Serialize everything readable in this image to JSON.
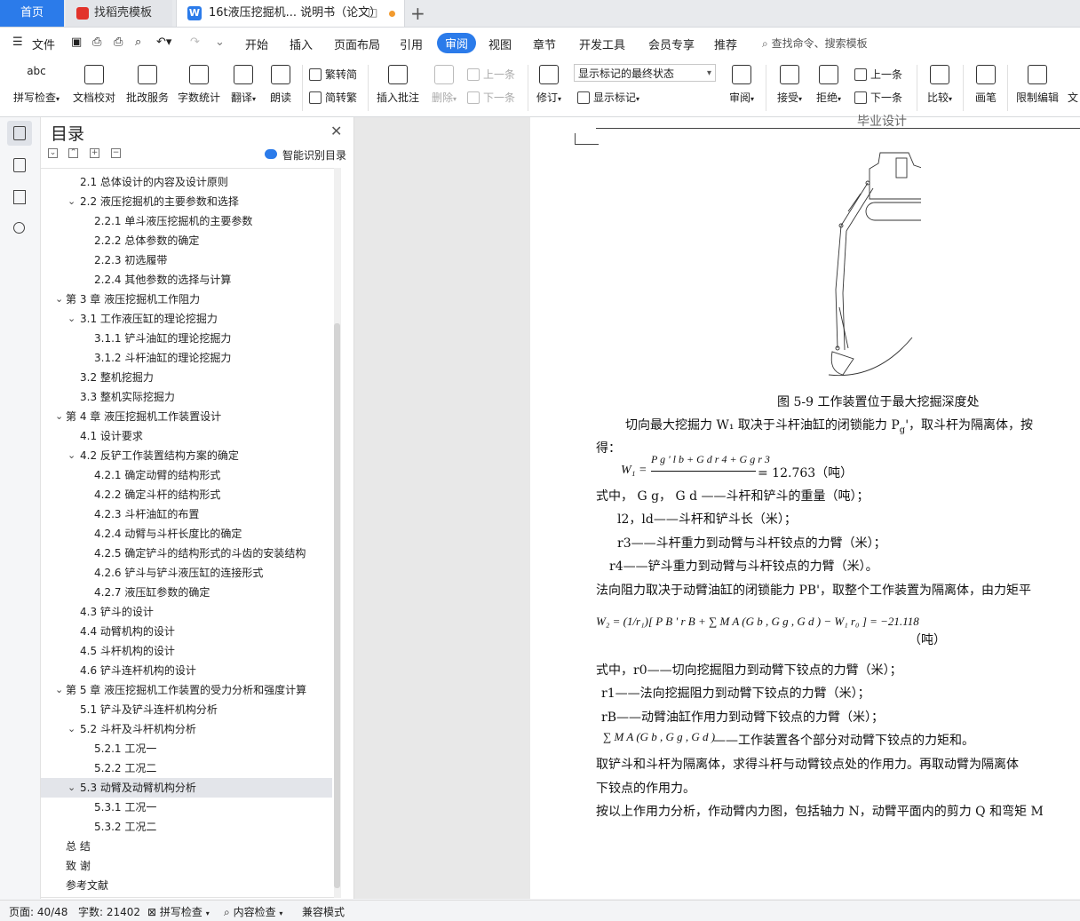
{
  "tabs": {
    "home": "首页",
    "template": "找稻壳模板",
    "doc": "16t液压挖掘机... 说明书（论文）"
  },
  "menu": {
    "file": "文件",
    "items": [
      "开始",
      "插入",
      "页面布局",
      "引用",
      "审阅",
      "视图",
      "章节",
      "开发工具",
      "会员专享",
      "推荐"
    ],
    "active": "审阅",
    "search": "查找命令、搜索模板"
  },
  "ribbon": {
    "spell": "拼写检查",
    "proofread": "文档校对",
    "batch": "批改服务",
    "wordcount": "字数统计",
    "translate": "翻译",
    "read": "朗读",
    "trad": "繁转简",
    "simp": "简转繁",
    "comment": "插入批注",
    "delete": "删除",
    "prev_comment": "上一条",
    "next_comment": "下一条",
    "revise": "修订",
    "markup_state": "显示标记的最终状态",
    "show_markup": "显示标记",
    "review": "审阅",
    "accept": "接受",
    "reject": "拒绝",
    "prev_change": "上一条",
    "next_change": "下一条",
    "compare": "比较",
    "pen": "画笔",
    "restrict": "限制编辑",
    "doc_more": "文"
  },
  "toc": {
    "title": "目录",
    "smart": "智能识别目录",
    "items": [
      {
        "label": "2.1  总体设计的内容及设计原则",
        "level": 2,
        "caret": ""
      },
      {
        "label": "2.2  液压挖掘机的主要参数和选择",
        "level": 2,
        "caret": "v"
      },
      {
        "label": "2.2.1  单斗液压挖掘机的主要参数",
        "level": 3,
        "caret": ""
      },
      {
        "label": "2.2.2  总体参数的确定",
        "level": 3,
        "caret": ""
      },
      {
        "label": "2.2.3 初选履带",
        "level": 3,
        "caret": ""
      },
      {
        "label": "2.2.4 其他参数的选择与计算",
        "level": 3,
        "caret": ""
      },
      {
        "label": "第 3 章  液压挖掘机工作阻力",
        "level": 1,
        "caret": "v"
      },
      {
        "label": "3.1  工作液压缸的理论挖掘力",
        "level": 2,
        "caret": "v"
      },
      {
        "label": "3.1.1 铲斗油缸的理论挖掘力",
        "level": 3,
        "caret": ""
      },
      {
        "label": "3.1.2  斗杆油缸的理论挖掘力",
        "level": 3,
        "caret": ""
      },
      {
        "label": "3.2  整机挖掘力",
        "level": 2,
        "caret": ""
      },
      {
        "label": "3.3  整机实际挖掘力",
        "level": 2,
        "caret": ""
      },
      {
        "label": "第 4 章  液压挖掘机工作装置设计",
        "level": 1,
        "caret": "v"
      },
      {
        "label": "4.1 设计要求",
        "level": 2,
        "caret": ""
      },
      {
        "label": "4.2 反铲工作装置结构方案的确定",
        "level": 2,
        "caret": "v"
      },
      {
        "label": "4.2.1 确定动臂的结构形式",
        "level": 3,
        "caret": ""
      },
      {
        "label": "4.2.2 确定斗杆的结构形式",
        "level": 3,
        "caret": ""
      },
      {
        "label": "4.2.3 斗杆油缸的布置",
        "level": 3,
        "caret": ""
      },
      {
        "label": "4.2.4 动臂与斗杆长度比的确定",
        "level": 3,
        "caret": ""
      },
      {
        "label": "4.2.5 确定铲斗的结构形式的斗齿的安装结构",
        "level": 3,
        "caret": ""
      },
      {
        "label": "4.2.6 铲斗与铲斗液压缸的连接形式",
        "level": 3,
        "caret": ""
      },
      {
        "label": "4.2.7 液压缸参数的确定",
        "level": 3,
        "caret": ""
      },
      {
        "label": "4.3  铲斗的设计",
        "level": 2,
        "caret": ""
      },
      {
        "label": "4.4 动臂机构的设计",
        "level": 2,
        "caret": ""
      },
      {
        "label": "4.5 斗杆机构的设计",
        "level": 2,
        "caret": ""
      },
      {
        "label": "4.6  铲斗连杆机构的设计",
        "level": 2,
        "caret": ""
      },
      {
        "label": "第 5 章  液压挖掘机工作装置的受力分析和强度计算",
        "level": 1,
        "caret": "v"
      },
      {
        "label": "5.1 铲斗及铲斗连杆机构分析",
        "level": 2,
        "caret": ""
      },
      {
        "label": "5.2 斗杆及斗杆机构分析",
        "level": 2,
        "caret": "v"
      },
      {
        "label": "5.2.1 工况一",
        "level": 3,
        "caret": ""
      },
      {
        "label": "5.2.2 工况二",
        "level": 3,
        "caret": ""
      },
      {
        "label": "5.3 动臂及动臂机构分析",
        "level": 2,
        "caret": "v",
        "selected": true
      },
      {
        "label": "5.3.1 工况一",
        "level": 3,
        "caret": ""
      },
      {
        "label": "5.3.2 工况二",
        "level": 3,
        "caret": ""
      },
      {
        "label": "总    结",
        "level": 1,
        "caret": ""
      },
      {
        "label": "致    谢",
        "level": 1,
        "caret": ""
      },
      {
        "label": "参考文献",
        "level": 1,
        "caret": ""
      }
    ]
  },
  "document": {
    "header": "毕业设计",
    "figure_caption": "图 5-9 工作装置位于最大挖掘深度处",
    "p1": "切向最大挖掘力 W₁ 取决于斗杆油缸的闭锁能力 P",
    "p1b": "g",
    "p1c": "'，取斗杆为隔离体，按",
    "p1d": "得：",
    "eq1_lhs": "W₁ =",
    "eq1_num": "P g ' l b + G d r 4 + G g r 3",
    "eq1_val": "= 12.763（吨）",
    "w1": "式中， G g， G d ——斗杆和铲斗的重量（吨）；",
    "w2": "l2，ld——斗杆和铲斗长（米）；",
    "w3": "r3——斗杆重力到动臂与斗杆铰点的力臂（米）；",
    "w4": "r4——铲斗重力到动臂与斗杆铰点的力臂（米）。",
    "p2": "法向阻力取决于动臂油缸的闭锁能力 PB'，取整个工作装置为隔离体，由力矩平",
    "eq2": "W₂ = (1/r₁)[ P B ' r B + ∑ M A (G b , G g , G d ) − W₁ r₀ ] = −21.118",
    "eq2_unit": "（吨）",
    "w5": "式中，r0——切向挖掘阻力到动臂下铰点的力臂（米）；",
    "w6": "r1——法向挖掘阻力到动臂下铰点的力臂（米）；",
    "w7": "rB——动臂油缸作用力到动臂下铰点的力臂（米）；",
    "w8a": "∑ M A (G b , G g , G d )",
    "w8b": "——工作装置各个部分对动臂下铰点的力矩和。",
    "p3": "取铲斗和斗杆为隔离体，求得斗杆与动臂铰点处的作用力。再取动臂为隔离体",
    "p3b": "下铰点的作用力。",
    "p4": "按以上作用力分析，作动臂内力图，包括轴力 N，动臂平面内的剪力 Q 和弯矩 M"
  },
  "status": {
    "page": "页面: 40/48",
    "words": "字数: 21402",
    "spell": "拼写检查",
    "content": "内容检查",
    "compat": "兼容模式"
  },
  "colors": {
    "accent": "#2b7bea",
    "home_tab": "#2b7bea",
    "wps_red": "#e2332b"
  }
}
